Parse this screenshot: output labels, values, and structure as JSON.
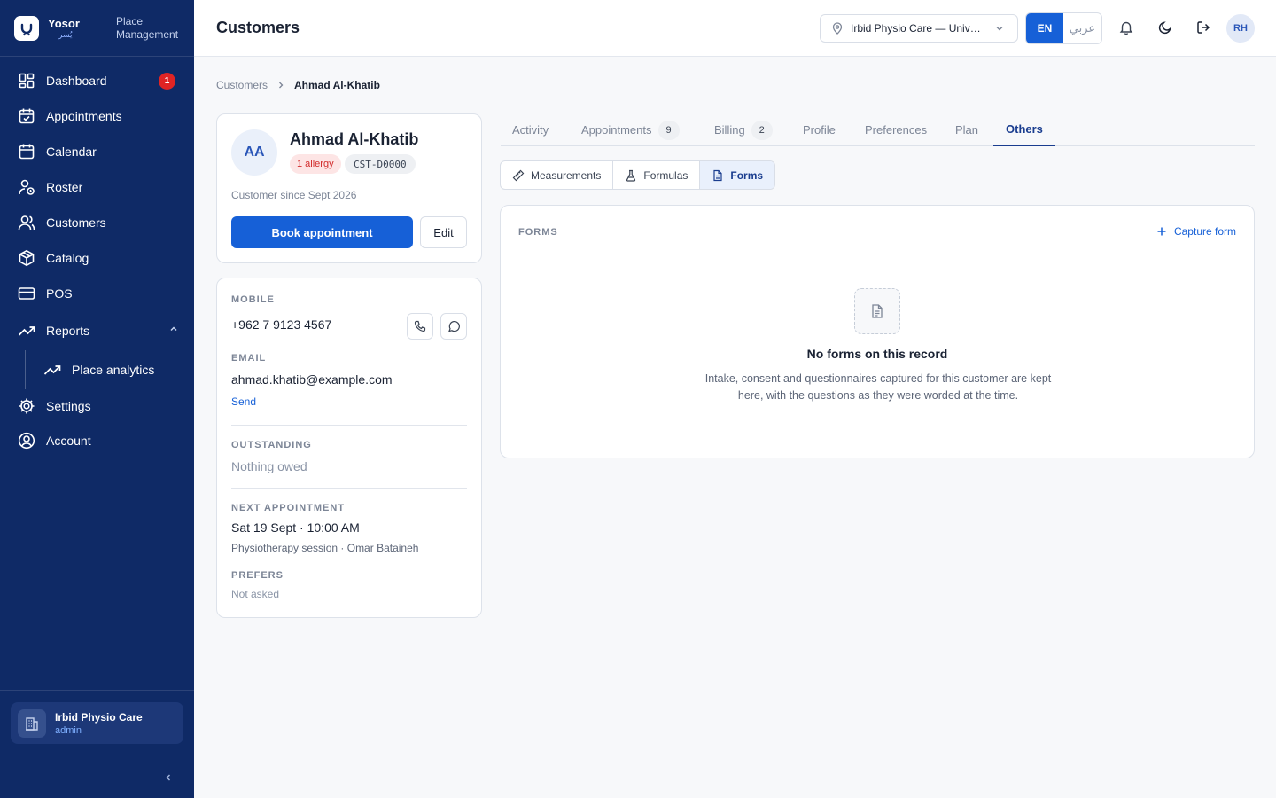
{
  "brand": {
    "name": "Yosor",
    "name_ar": "يُسر",
    "subtitle_line1": "Place",
    "subtitle_line2": "Management"
  },
  "sidebar": {
    "items": [
      {
        "label": "Dashboard",
        "icon": "grid-icon",
        "badge": "1"
      },
      {
        "label": "Appointments",
        "icon": "calendar-check-icon"
      },
      {
        "label": "Calendar",
        "icon": "calendar-icon"
      },
      {
        "label": "Roster",
        "icon": "user-clock-icon"
      },
      {
        "label": "Customers",
        "icon": "users-icon"
      },
      {
        "label": "Catalog",
        "icon": "package-icon"
      },
      {
        "label": "POS",
        "icon": "credit-card-icon"
      },
      {
        "label": "Reports",
        "icon": "trending-up-icon"
      },
      {
        "label": "Place analytics",
        "icon": "trending-up-icon"
      },
      {
        "label": "Settings",
        "icon": "gear-icon"
      },
      {
        "label": "Account",
        "icon": "user-circle-icon"
      }
    ],
    "place": {
      "name": "Irbid Physio Care",
      "role": "admin"
    }
  },
  "header": {
    "title": "Customers",
    "place_select": "Irbid Physio Care — University Street",
    "lang_en": "EN",
    "lang_ar": "عربي",
    "user_initials": "RH"
  },
  "breadcrumb": {
    "parent": "Customers",
    "current": "Ahmad Al-Khatib"
  },
  "customer": {
    "initials": "AA",
    "name": "Ahmad Al-Khatib",
    "allergy": "1 allergy",
    "code": "CST-D0000",
    "since": "Customer since Sept 2026",
    "book_label": "Book appointment",
    "edit_label": "Edit"
  },
  "details": {
    "mobile_label": "MOBILE",
    "mobile": "+962 7 9123 4567",
    "email_label": "EMAIL",
    "email": "ahmad.khatib@example.com",
    "send_label": "Send",
    "outstanding_label": "OUTSTANDING",
    "outstanding": "Nothing owed",
    "next_label": "NEXT APPOINTMENT",
    "next_when": "Sat 19 Sept · 10:00 AM",
    "next_what": "Physiotherapy session · Omar Bataineh",
    "prefers_label": "PREFERS",
    "prefers": "Not asked"
  },
  "tabs": [
    {
      "label": "Activity"
    },
    {
      "label": "Appointments",
      "count": "9"
    },
    {
      "label": "Billing",
      "count": "2"
    },
    {
      "label": "Profile"
    },
    {
      "label": "Preferences"
    },
    {
      "label": "Plan"
    },
    {
      "label": "Others",
      "active": true
    }
  ],
  "subtabs": [
    {
      "label": "Measurements"
    },
    {
      "label": "Formulas"
    },
    {
      "label": "Forms",
      "active": true
    }
  ],
  "forms": {
    "title": "FORMS",
    "capture_label": "Capture form",
    "empty_title": "No forms on this record",
    "empty_desc": "Intake, consent and questionnaires captured for this customer are kept here, with the questions as they were worded at the time."
  },
  "colors": {
    "sidebar": "#0f2a66",
    "primary": "#1660d7",
    "active_tab": "#1a3d8f",
    "danger": "#e02424"
  }
}
